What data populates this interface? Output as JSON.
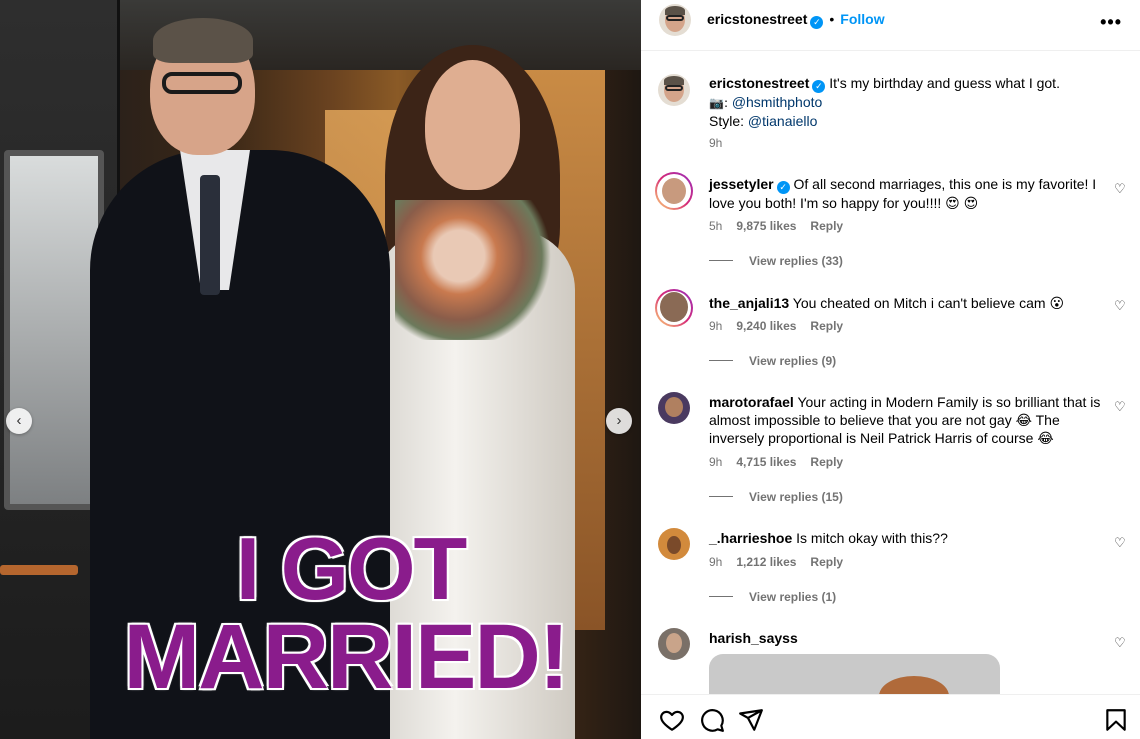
{
  "post": {
    "overlay_line1": "I GOT",
    "overlay_line2": "MARRIED!",
    "colors": {
      "overlay_text": "#8a1c8c"
    }
  },
  "header": {
    "username": "ericstonestreet",
    "separator": "•",
    "follow_label": "Follow",
    "more_label": "•••"
  },
  "caption": {
    "username": "ericstonestreet",
    "line1": "It's my birthday and guess what I got.",
    "line2_prefix": "📷: ",
    "line2_mention": "@hsmithphoto",
    "line3_prefix": "Style: ",
    "line3_mention": "@tianaiello",
    "time": "9h"
  },
  "comments": [
    {
      "username": "jessetyler",
      "verified": true,
      "text": "Of all second marriages, this one is my favorite! I love you both! I'm so happy for you!!!! 😍 😍",
      "time": "5h",
      "likes": "9,875 likes",
      "reply": "Reply",
      "view_replies": "View replies (33)"
    },
    {
      "username": "the_anjali13",
      "verified": false,
      "text": "You cheated on Mitch i can't believe cam 😮",
      "time": "9h",
      "likes": "9,240 likes",
      "reply": "Reply",
      "view_replies": "View replies (9)"
    },
    {
      "username": "marotorafael",
      "verified": false,
      "text": "Your acting in Modern Family is so brilliant that is almost impossible to believe that you are not gay 😂 The inversely proportional is Neil Patrick Harris of course 😂",
      "time": "9h",
      "likes": "4,715 likes",
      "reply": "Reply",
      "view_replies": "View replies (15)"
    },
    {
      "username": "_.harrieshoe",
      "verified": false,
      "text": "Is mitch okay with this??",
      "time": "9h",
      "likes": "1,212 likes",
      "reply": "Reply",
      "view_replies": "View replies (1)"
    },
    {
      "username": "harish_sayss",
      "verified": false,
      "text": "",
      "time": "",
      "likes": "",
      "reply": "",
      "view_replies": ""
    }
  ],
  "icons": {
    "heart": "heart-icon",
    "comment": "comment-icon",
    "share": "share-icon",
    "save": "bookmark-icon",
    "prev": "chevron-left-icon",
    "next": "chevron-right-icon"
  },
  "nav": {
    "prev_glyph": "‹",
    "next_glyph": "›"
  }
}
